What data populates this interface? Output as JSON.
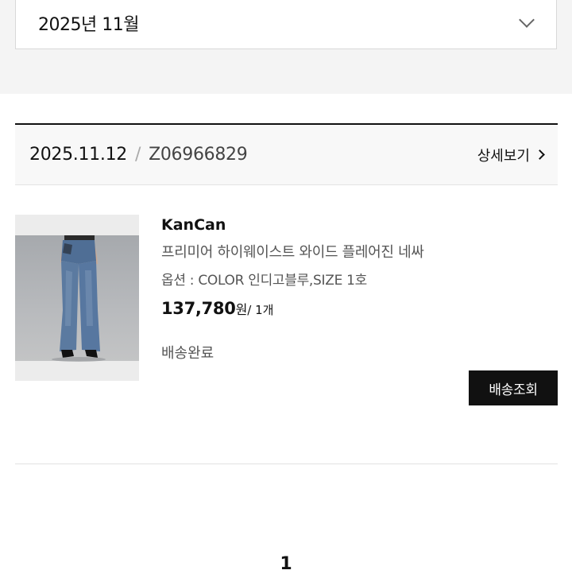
{
  "month_filter": {
    "selected": "2025년 11월",
    "icon": "chevron-down-icon"
  },
  "order": {
    "date": "2025.11.12",
    "separator": "/",
    "order_number": "Z06966829",
    "detail_link": "상세보기",
    "detail_icon": "chevron-right-icon"
  },
  "product": {
    "brand": "KanCan",
    "name": "프리미어 하이웨이스트 와이드 플레어진 네싸",
    "option": "옵션 : COLOR 인디고블루,SIZE 1호",
    "price": "137,780",
    "currency": "원",
    "quantity": "/ 1개",
    "status": "배송완료",
    "image_description_icon": "product-photo-jeans"
  },
  "actions": {
    "track_shipping": "배송조회"
  },
  "pagination": {
    "current_page": "1"
  },
  "colors": {
    "accent": "#111111",
    "background_band": "#f4f4f4",
    "header_background": "#f8f8f8",
    "muted_text": "#555555"
  }
}
